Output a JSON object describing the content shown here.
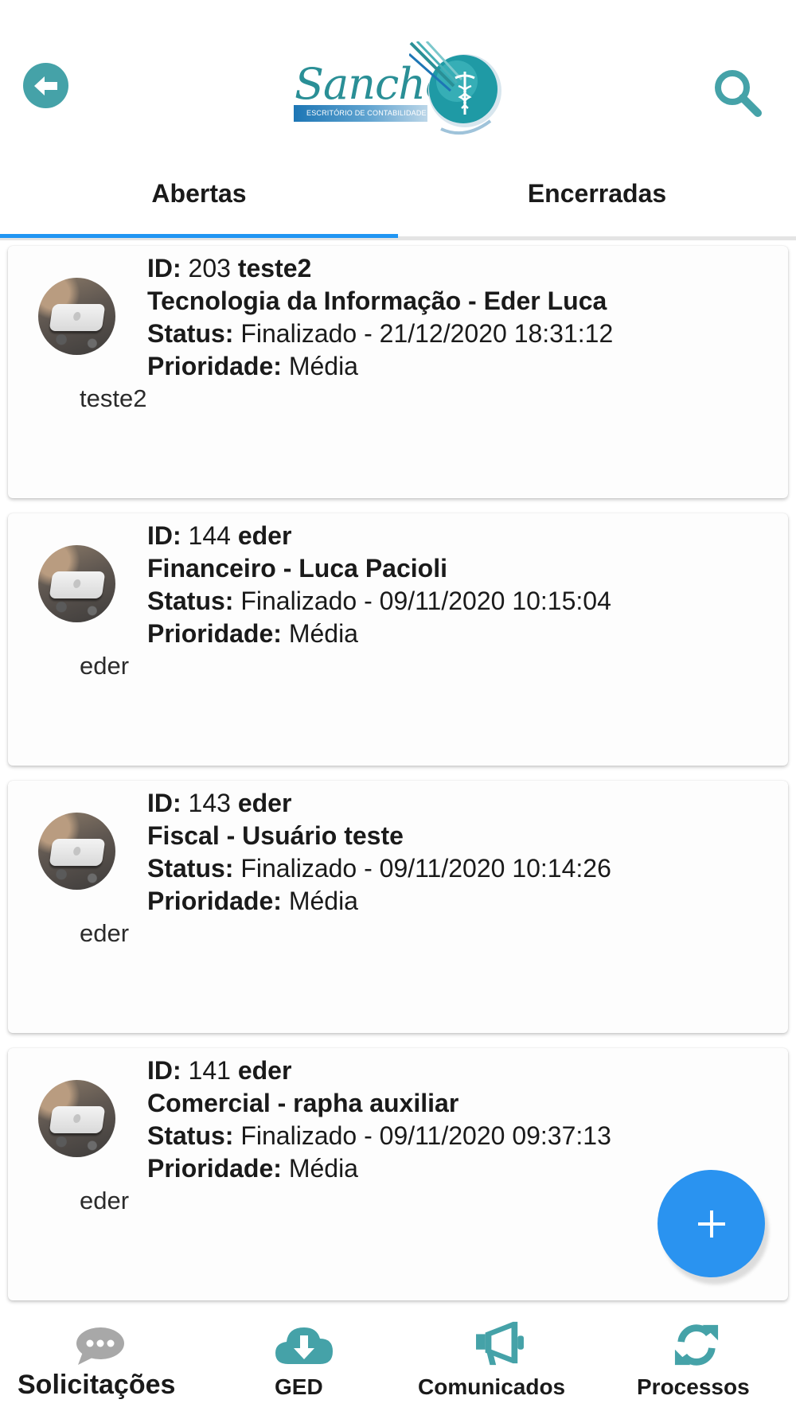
{
  "header": {
    "back_icon": "arrow-left-circle-icon",
    "search_icon": "search-icon",
    "logo": {
      "script_text": "Sanches",
      "band_text": "ESCRITÓRIO DE CONTABILIDADE"
    }
  },
  "tabs": [
    {
      "label": "Abertas",
      "active": true
    },
    {
      "label": "Encerradas",
      "active": false
    }
  ],
  "labels": {
    "id": "ID:",
    "status": "Status:",
    "priority": "Prioridade:"
  },
  "tickets": [
    {
      "id": "203",
      "user": "teste2",
      "department_person": "Tecnologia da Informação - Eder Luca",
      "status": "Finalizado - 21/12/2020 18:31:12",
      "priority": "Média",
      "description": "teste2"
    },
    {
      "id": "144",
      "user": "eder",
      "department_person": "Financeiro - Luca Pacioli",
      "status": "Finalizado - 09/11/2020 10:15:04",
      "priority": "Média",
      "description": "eder"
    },
    {
      "id": "143",
      "user": "eder",
      "department_person": "Fiscal - Usuário teste",
      "status": "Finalizado - 09/11/2020 10:14:26",
      "priority": "Média",
      "description": "eder"
    },
    {
      "id": "141",
      "user": "eder",
      "department_person": "Comercial - rapha auxiliar",
      "status": "Finalizado - 09/11/2020 09:37:13",
      "priority": "Média",
      "description": "eder"
    }
  ],
  "fab": {
    "icon": "plus-icon"
  },
  "bottom_nav": [
    {
      "label": "Solicitações",
      "icon": "chat-bubble-icon",
      "active": true
    },
    {
      "label": "GED",
      "icon": "cloud-download-icon",
      "active": false
    },
    {
      "label": "Comunicados",
      "icon": "megaphone-icon",
      "active": false
    },
    {
      "label": "Processos",
      "icon": "refresh-icon",
      "active": false
    }
  ],
  "colors": {
    "teal": "#45a2a8",
    "tab_indicator": "#2196f3",
    "fab": "#2a93f0",
    "inactive_icon": "#a8a8a8"
  }
}
